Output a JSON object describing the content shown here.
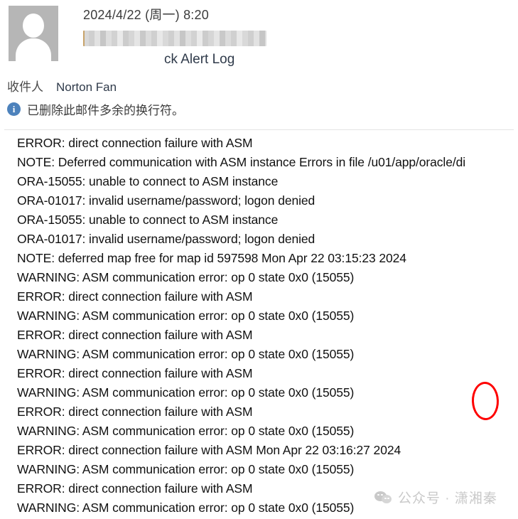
{
  "message": {
    "date": "2024/4/22 (周一) 8:20",
    "sender_redacted": true,
    "subject_visible_tail": "ck Alert Log",
    "to_label": "收件人",
    "to_name": "Norton Fan",
    "notice": "已删除此邮件多余的换行符。",
    "notice_icon": "info-icon",
    "avatar_icon": "person-avatar-icon"
  },
  "log": {
    "lines": [
      "ERROR: direct connection failure with ASM",
      "NOTE: Deferred communication with ASM instance Errors in file /u01/app/oracle/di",
      "ORA-15055: unable to connect to ASM instance",
      "ORA-01017: invalid username/password; logon denied",
      "ORA-15055: unable to connect to ASM instance",
      "ORA-01017: invalid username/password; logon denied",
      "NOTE: deferred map free for map id 597598 Mon Apr 22 03:15:23 2024",
      "WARNING: ASM communication error: op 0 state 0x0 (15055)",
      "ERROR: direct connection failure with ASM",
      "WARNING: ASM communication error: op 0 state 0x0 (15055)",
      "ERROR: direct connection failure with ASM",
      "WARNING: ASM communication error: op 0 state 0x0 (15055)",
      "ERROR: direct connection failure with ASM",
      "WARNING: ASM communication error: op 0 state 0x0 (15055)",
      "ERROR: direct connection failure with ASM",
      "WARNING: ASM communication error: op 0 state 0x0 (15055)",
      "ERROR: direct connection failure with ASM Mon Apr 22 03:16:27 2024",
      "WARNING: ASM communication error: op 0 state 0x0 (15055)",
      "ERROR: direct connection failure with ASM",
      "WARNING: ASM communication error: op 0 state 0x0 (15055)"
    ]
  },
  "annotations": {
    "ellipse_color": "#fe0000",
    "ellipse_name": "red-circle-highlight"
  },
  "watermark": {
    "text": "公众号 · 潇湘秦",
    "icon": "wechat-icon",
    "color": "#c9c9c9"
  }
}
